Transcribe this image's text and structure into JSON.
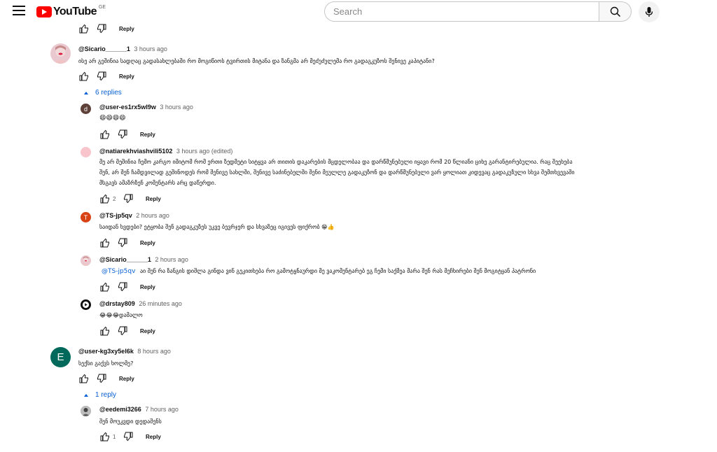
{
  "header": {
    "logo_text": "YouTube",
    "country_code": "GE",
    "search_placeholder": "Search"
  },
  "reply_label": "Reply",
  "comments": [
    {
      "author": "@Sicario______1",
      "time": "3 hours ago",
      "text": "ისე არ გეშინია სადღაც გადასახლებაში რო მოგიწიოს ტვირთის მიტანა და ზანგმა არ მეძუძულემა რო გადაგკუზოს შენივე კაპიტანი?",
      "avatar_color": "#e9c9cf"
    },
    {
      "replies_toggle": "6 replies",
      "author": "@user-es1rx5wl9w",
      "time": "3 hours ago",
      "text": "😄😄😄😄",
      "avatar_letter": "d",
      "avatar_color": "#5d4037"
    },
    {
      "author": "@natiarekhviashvili5102",
      "time": "3 hours ago (edited)",
      "text_lines": [
        "მე არ მეშინია ჩემო კარგო იმიტომ რომ ერთი ზედმეტი სიტყვა არ თითის დაკარების მცდელობაა და დარწმუნებული იყავი რომ 20 წლიანი ციხე გარანტირებულია. რაც შეეხება",
        "შენ, არ შენ ჩამდვილად გეშინოდეს რომ შენივე სახლში, შენივე საძინებელში შენი მეულლე გადაკუზონ და დარწმუნებული ვარ ყოლიათ კიდევაც გადაკუზული სხვა შემთხვევაში",
        "მსგავს ამაზრზენ კომენტარს არც დაწერდი."
      ],
      "likes": "2",
      "avatar_color": "#f8c5cc"
    },
    {
      "author": "@TS-jp5qv",
      "time": "2 hours ago",
      "text": "საიდან ხვდები? ეტყობა შენ გადაგკუზეს უკვე ბევრჯერ და სხვაზეც იგივეს ფიქრობ 😁👍",
      "avatar_letter": "T",
      "avatar_color": "#d84315"
    },
    {
      "author": "@Sicario______1",
      "time": "2 hours ago",
      "mention": "@TS-jp5qv",
      "text": "აი შენ რა ზანგის დიშლა გინდა ვინ გეკითხება რო გამოტყნაურდი მე ვაკომენტარებ ეგ ჩემი საქმეა მარა შენ რას მეჩხირები შენ მოგიტყან პატრონი",
      "avatar_color": "#e9c9cf"
    },
    {
      "author": "@drstay809",
      "time": "26 minutes ago",
      "text": "😂😂😂დამალო",
      "avatar_color": "#0f0f0f"
    },
    {
      "author": "@user-kg3xy5el6k",
      "time": "8 hours ago",
      "text": "სექსი გაქვს ხოლმე?",
      "avatar_letter": "E",
      "avatar_color": "#00695c"
    },
    {
      "replies_toggle": "1 reply",
      "author": "@eedemi3266",
      "time": "7 hours ago",
      "text": "შენ მოუკვდი დედაშენს",
      "likes": "1",
      "avatar_color": "#9e9e9e"
    }
  ]
}
